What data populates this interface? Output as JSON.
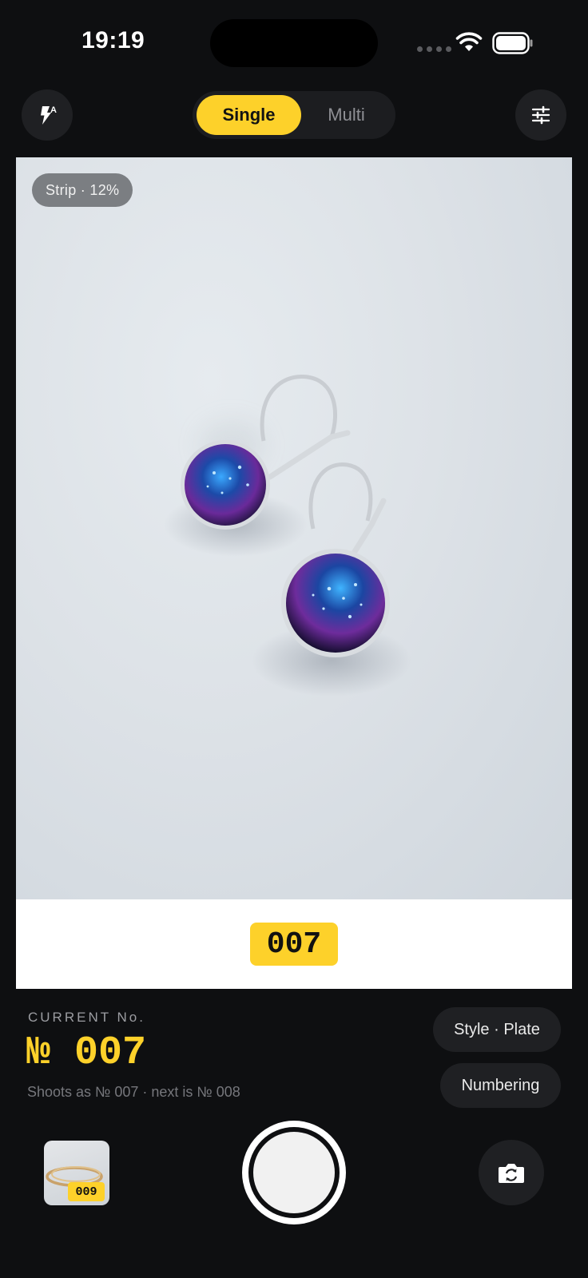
{
  "status_bar": {
    "time": "19:19"
  },
  "top_bar": {
    "modes": {
      "single": "Single",
      "multi": "Multi"
    },
    "selected_mode": "Single",
    "flash_icon": "flash-auto-icon",
    "settings_icon": "sliders-icon"
  },
  "viewfinder": {
    "strip_badge": "Strip · 12%",
    "plate_number": "007"
  },
  "current": {
    "label": "CURRENT No.",
    "number": "№ 007",
    "subtitle": "Shoots as № 007 · next is № 008"
  },
  "buttons": {
    "style": "Style · Plate",
    "numbering": "Numbering"
  },
  "bottom_bar": {
    "thumbnail_number": "009",
    "flip_icon": "camera-flip-icon"
  },
  "colors": {
    "accent": "#fdd12a",
    "background": "#0e0f11",
    "button": "#1f2023"
  }
}
